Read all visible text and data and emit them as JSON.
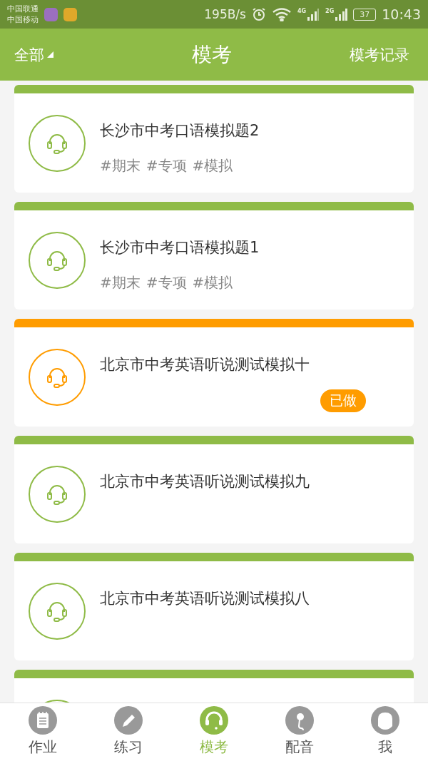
{
  "status_bar": {
    "carriers": [
      "中国联通",
      "中国移动"
    ],
    "speed": "195B/s",
    "network_1": "4G",
    "network_2": "2G",
    "battery": "37",
    "time": "10:43"
  },
  "header": {
    "filter": "全部",
    "title": "模考",
    "action": "模考记录"
  },
  "cards": [
    {
      "title": "长沙市中考口语模拟题2",
      "tags": [
        "#期末",
        "#专项",
        "#模拟"
      ],
      "done": false
    },
    {
      "title": "长沙市中考口语模拟题1",
      "tags": [
        "#期末",
        "#专项",
        "#模拟"
      ],
      "done": false
    },
    {
      "title": "北京市中考英语听说测试模拟十",
      "badge": "已做",
      "done": true
    },
    {
      "title": "北京市中考英语听说测试模拟九",
      "done": false
    },
    {
      "title": "北京市中考英语听说测试模拟八",
      "done": false
    },
    {
      "done": false
    }
  ],
  "nav": [
    {
      "label": "作业",
      "kind": "notepad",
      "selected": false
    },
    {
      "label": "练习",
      "kind": "pencil",
      "selected": false
    },
    {
      "label": "模考",
      "kind": "headset",
      "selected": true
    },
    {
      "label": "配音",
      "kind": "microphone",
      "selected": false
    },
    {
      "label": "我",
      "kind": "person",
      "selected": false
    }
  ]
}
